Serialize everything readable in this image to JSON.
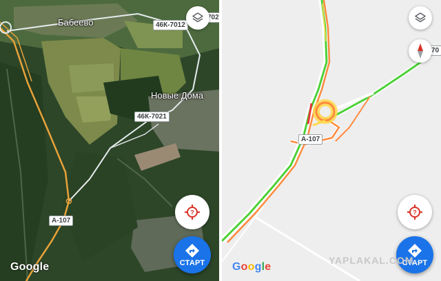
{
  "left_map": {
    "places": [
      "Бабеево",
      "Новые Дома"
    ],
    "roads": [
      "46К-7012",
      "46К-7021",
      "A-107"
    ],
    "road_edge_label": "702",
    "logo": "Google",
    "start_label": "СТАРТ",
    "icons": [
      "layers-icon",
      "unknown-location-icon",
      "navigation-arrow-icon"
    ]
  },
  "right_map": {
    "roads": [
      "A-107"
    ],
    "road_edge_label": "70",
    "logo": "Google",
    "start_label": "СТАРТ",
    "watermark": "YAPLAKAL.COM",
    "icons": [
      "layers-icon",
      "compass-icon",
      "unknown-location-icon",
      "navigation-arrow-icon"
    ]
  },
  "colors": {
    "satellite_forest": "#2f4a2a",
    "road_highway": "#e8a23a",
    "traffic_green": "#4cd137",
    "traffic_orange": "#ff8a3d",
    "traffic_yellow": "#ffd84a",
    "traffic_red": "#e53935",
    "start_blue": "#1a73e8"
  }
}
